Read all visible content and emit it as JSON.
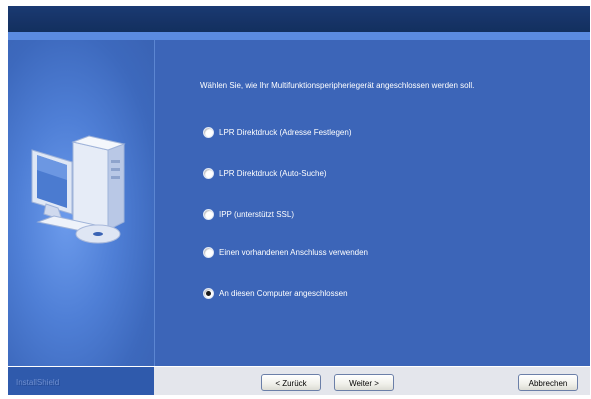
{
  "main": {
    "prompt": "Wählen Sie, wie Ihr Multifunktionsperipheriegerät angeschlossen werden soll.",
    "options": [
      {
        "label": "LPR Direktdruck (Adresse Festlegen)",
        "checked": false
      },
      {
        "label": "LPR Direktdruck (Auto-Suche)",
        "checked": false
      },
      {
        "label": "IPP (unterstützt SSL)",
        "checked": false
      },
      {
        "label": "Einen vorhandenen Anschluss verwenden",
        "checked": false
      },
      {
        "label": "An diesen Computer angeschlossen",
        "checked": true
      }
    ]
  },
  "footer": {
    "installshield": "InstallShield",
    "back_label": "< Zurück",
    "next_label": "Weiter >",
    "cancel_label": "Abbrechen"
  },
  "icons": {
    "wizard_graphic": "computer-with-cd-icon",
    "radio_unchecked": "radio-button",
    "radio_checked": "radio-button-selected"
  }
}
